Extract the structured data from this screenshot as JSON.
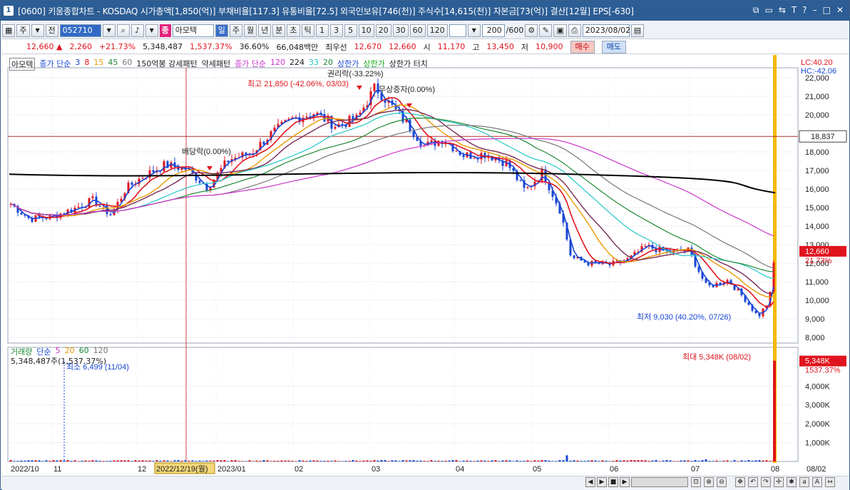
{
  "title": "[0600] 키움종합차트 - KOSDAQ 시가총액[1,850(억)] 부채비율[117.3] 유통비율[72.5] 외국인보유[746(천)] 주식수[14,615(천)] 자본금[73(억)] 결산[12월] EPS[-630]",
  "window_num": "1",
  "toolbar": {
    "btn_ju": "주",
    "btn_jeon": "전",
    "code": "052710",
    "stock_tag": "종",
    "stock_name": "아모텍",
    "period_il": "일",
    "period_ju": "주",
    "period_wol": "월",
    "period_nyeon": "년",
    "period_bun": "분",
    "period_cho": "초",
    "period_tik": "틱",
    "n1": "1",
    "n3": "3",
    "n5": "5",
    "n10": "10",
    "n20": "20",
    "n30": "30",
    "n60": "60",
    "n120": "120",
    "count": "200",
    "count_total": "/600",
    "date": "2023/08/02"
  },
  "quote": {
    "price": "12,660",
    "arrow": "▲",
    "change": "2,260",
    "change_pct": "+21.73%",
    "volume": "5,348,487",
    "vol_pct": "1,537.37%",
    "turnover": "36.60%",
    "amount": "66,048백만",
    "priority_label": "최우선",
    "priority_val": "12,670",
    "priority_val2": "12,660",
    "open_label": "시",
    "open": "11,170",
    "high_label": "고",
    "high": "13,450",
    "low_label": "저",
    "low": "10,900",
    "buy": "매수",
    "sell": "매도"
  },
  "legend_main": {
    "name": "아모텍",
    "ma_label": "종가 단순",
    "ma3": "3",
    "ma8": "8",
    "ma15": "15",
    "ma45": "45",
    "ma60": "60",
    "pattern": "150억봉 강세패턴",
    "weak": "약세패턴",
    "ma2_label": "종가 단순",
    "ma120": "120",
    "ma224": "224",
    "ma33": "33",
    "ma20": "20",
    "upper": "상한가",
    "upper2": "상한가",
    "upper_touch": "상한가 터치"
  },
  "legend_volume": {
    "label": "거래량",
    "ma_label": "단순",
    "v5": "5",
    "v20": "20",
    "v60": "60",
    "v120": "120",
    "cur": "5,348,487주(1,537.37%)"
  },
  "annotations": {
    "rights": "권리락(-33.22%)",
    "high": "최고 21,850 (-42.06%, 03/03)",
    "free_cap": "무상증자(0.00%)",
    "dividend": "배당락(0.00%)",
    "low": "최저 9,030 (40.20%, 07/26)",
    "vol_max": "최대 5,348K (08/02)",
    "vol_min": "최소 6,499 (11/04)"
  },
  "price_axis": {
    "ticks": [
      "22,000",
      "21,000",
      "20,000",
      "19,000",
      "18,000",
      "17,000",
      "16,000",
      "15,000",
      "14,000",
      "13,000",
      "12,000",
      "11,000",
      "10,000",
      "9,000",
      "8,000"
    ],
    "lc": "LC:40.20",
    "hc": "HC:-42.06",
    "crosshair": "18,837",
    "current": "12,660",
    "current_pct": "21.73%"
  },
  "volume_axis": {
    "ticks": [
      "4,000K",
      "3,000K",
      "2,000K",
      "1,000K"
    ],
    "current": "5,348K",
    "current_pct": "1537.37%"
  },
  "date_axis": {
    "labels": [
      "2022/10",
      "11",
      "12",
      "2023/01",
      "02",
      "03",
      "04",
      "05",
      "06",
      "07",
      "08",
      "08/02"
    ],
    "cursor_date": "2022/12/19(월)"
  },
  "colors": {
    "up": "#e0141e",
    "down": "#1846d6",
    "ma224": "#000000",
    "ma120": "#cc33cc",
    "ma60": "#777777",
    "ma33": "#23c7c7",
    "ma20": "#1f8a35",
    "ma15": "#e89a00",
    "ma8": "#e0141e",
    "ma3": "#1846d6",
    "ma45": "#7a2a55",
    "cursor": "#f5b800"
  }
}
